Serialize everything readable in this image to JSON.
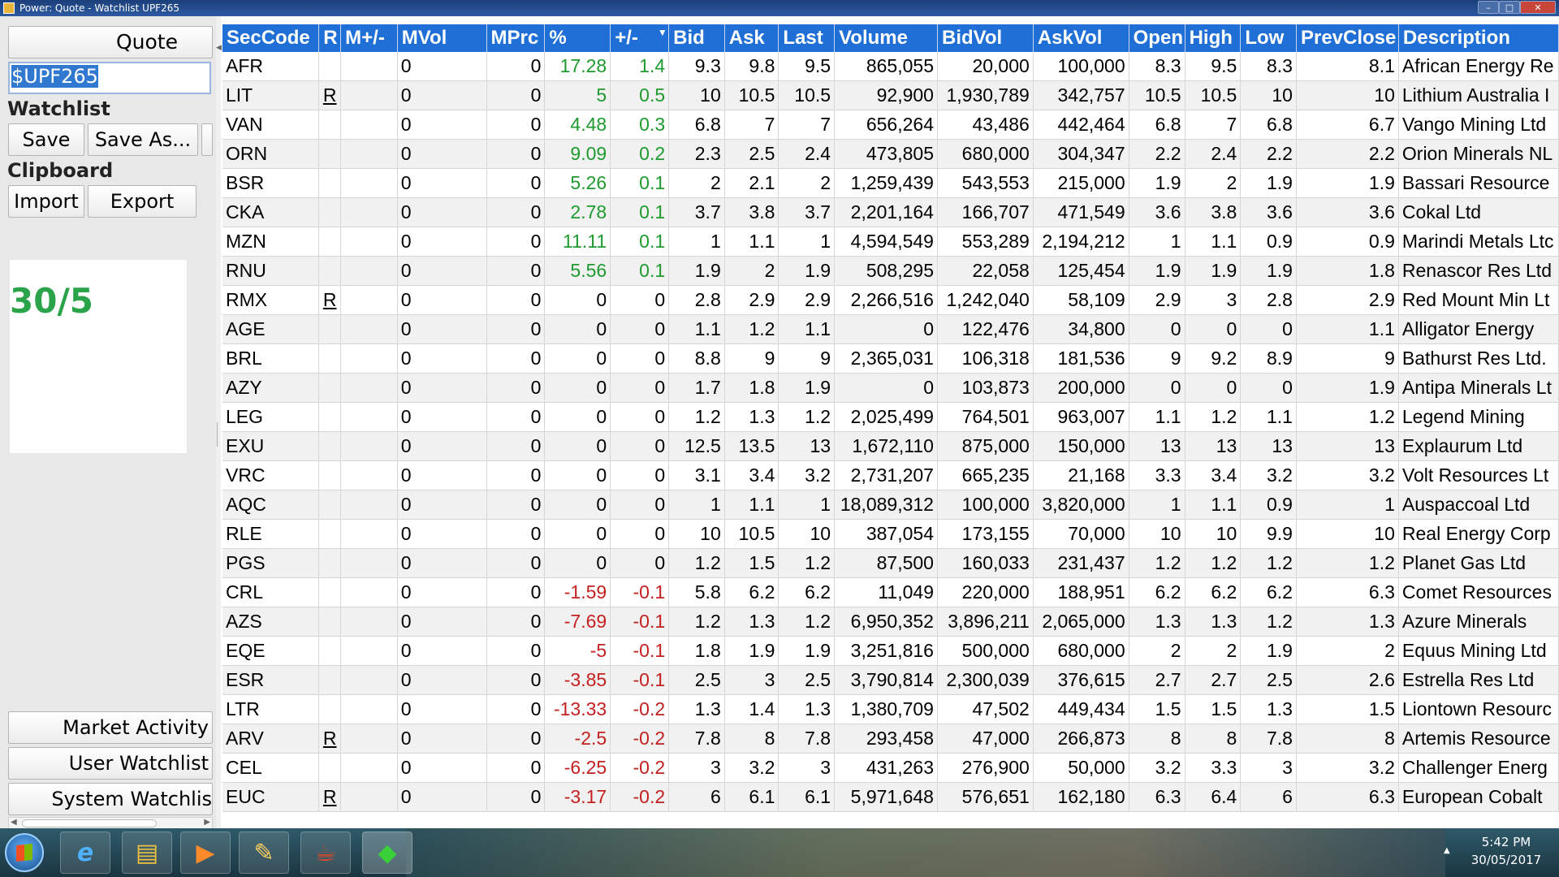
{
  "window": {
    "title": "Power: Quote - Watchlist UPF265"
  },
  "left": {
    "quote_label": "Quote",
    "search_value": "$UPF265",
    "watchlist_label": "Watchlist",
    "save_label": "Save",
    "saveas_label": "Save As...",
    "clipboard_label": "Clipboard",
    "import_label": "Import",
    "export_label": "Export",
    "date_text": "30/5",
    "market_activity_label": "Market Activity",
    "user_watchlist_label": "User Watchlist",
    "system_watchlist_label": "System Watchlis"
  },
  "table": {
    "headers": [
      "SecCode",
      "R",
      "M+/-",
      "MVol",
      "MPrc",
      "%",
      "+/-",
      "Bid",
      "Ask",
      "Last",
      "Volume",
      "BidVol",
      "AskVol",
      "Open",
      "High",
      "Low",
      "PrevClose",
      "Description"
    ],
    "rows": [
      [
        "AFR",
        "",
        "",
        "0",
        "0",
        "17.28",
        "1.4",
        "9.3",
        "9.8",
        "9.5",
        "865,055",
        "20,000",
        "100,000",
        "8.3",
        "9.5",
        "8.3",
        "8.1",
        "African Energy Re"
      ],
      [
        "LIT",
        "R",
        "",
        "0",
        "0",
        "5",
        "0.5",
        "10",
        "10.5",
        "10.5",
        "92,900",
        "1,930,789",
        "342,757",
        "10.5",
        "10.5",
        "10",
        "10",
        "Lithium Australia I"
      ],
      [
        "VAN",
        "",
        "",
        "0",
        "0",
        "4.48",
        "0.3",
        "6.8",
        "7",
        "7",
        "656,264",
        "43,486",
        "442,464",
        "6.8",
        "7",
        "6.8",
        "6.7",
        "Vango Mining Ltd"
      ],
      [
        "ORN",
        "",
        "",
        "0",
        "0",
        "9.09",
        "0.2",
        "2.3",
        "2.5",
        "2.4",
        "473,805",
        "680,000",
        "304,347",
        "2.2",
        "2.4",
        "2.2",
        "2.2",
        "Orion Minerals NL"
      ],
      [
        "BSR",
        "",
        "",
        "0",
        "0",
        "5.26",
        "0.1",
        "2",
        "2.1",
        "2",
        "1,259,439",
        "543,553",
        "215,000",
        "1.9",
        "2",
        "1.9",
        "1.9",
        "Bassari Resource"
      ],
      [
        "CKA",
        "",
        "",
        "0",
        "0",
        "2.78",
        "0.1",
        "3.7",
        "3.8",
        "3.7",
        "2,201,164",
        "166,707",
        "471,549",
        "3.6",
        "3.8",
        "3.6",
        "3.6",
        "Cokal Ltd"
      ],
      [
        "MZN",
        "",
        "",
        "0",
        "0",
        "11.11",
        "0.1",
        "1",
        "1.1",
        "1",
        "4,594,549",
        "553,289",
        "2,194,212",
        "1",
        "1.1",
        "0.9",
        "0.9",
        "Marindi Metals Ltc"
      ],
      [
        "RNU",
        "",
        "",
        "0",
        "0",
        "5.56",
        "0.1",
        "1.9",
        "2",
        "1.9",
        "508,295",
        "22,058",
        "125,454",
        "1.9",
        "1.9",
        "1.9",
        "1.8",
        "Renascor Res Ltd"
      ],
      [
        "RMX",
        "R",
        "",
        "0",
        "0",
        "0",
        "0",
        "2.8",
        "2.9",
        "2.9",
        "2,266,516",
        "1,242,040",
        "58,109",
        "2.9",
        "3",
        "2.8",
        "2.9",
        "Red Mount Min Lt"
      ],
      [
        "AGE",
        "",
        "",
        "0",
        "0",
        "0",
        "0",
        "1.1",
        "1.2",
        "1.1",
        "0",
        "122,476",
        "34,800",
        "0",
        "0",
        "0",
        "1.1",
        "Alligator Energy"
      ],
      [
        "BRL",
        "",
        "",
        "0",
        "0",
        "0",
        "0",
        "8.8",
        "9",
        "9",
        "2,365,031",
        "106,318",
        "181,536",
        "9",
        "9.2",
        "8.9",
        "9",
        "Bathurst Res Ltd."
      ],
      [
        "AZY",
        "",
        "",
        "0",
        "0",
        "0",
        "0",
        "1.7",
        "1.8",
        "1.9",
        "0",
        "103,873",
        "200,000",
        "0",
        "0",
        "0",
        "1.9",
        "Antipa Minerals Lt"
      ],
      [
        "LEG",
        "",
        "",
        "0",
        "0",
        "0",
        "0",
        "1.2",
        "1.3",
        "1.2",
        "2,025,499",
        "764,501",
        "963,007",
        "1.1",
        "1.2",
        "1.1",
        "1.2",
        "Legend Mining"
      ],
      [
        "EXU",
        "",
        "",
        "0",
        "0",
        "0",
        "0",
        "12.5",
        "13.5",
        "13",
        "1,672,110",
        "875,000",
        "150,000",
        "13",
        "13",
        "13",
        "13",
        "Explaurum Ltd"
      ],
      [
        "VRC",
        "",
        "",
        "0",
        "0",
        "0",
        "0",
        "3.1",
        "3.4",
        "3.2",
        "2,731,207",
        "665,235",
        "21,168",
        "3.3",
        "3.4",
        "3.2",
        "3.2",
        "Volt Resources Lt"
      ],
      [
        "AQC",
        "",
        "",
        "0",
        "0",
        "0",
        "0",
        "1",
        "1.1",
        "1",
        "18,089,312",
        "100,000",
        "3,820,000",
        "1",
        "1.1",
        "0.9",
        "1",
        "Auspaccoal Ltd"
      ],
      [
        "RLE",
        "",
        "",
        "0",
        "0",
        "0",
        "0",
        "10",
        "10.5",
        "10",
        "387,054",
        "173,155",
        "70,000",
        "10",
        "10",
        "9.9",
        "10",
        "Real Energy Corp"
      ],
      [
        "PGS",
        "",
        "",
        "0",
        "0",
        "0",
        "0",
        "1.2",
        "1.5",
        "1.2",
        "87,500",
        "160,033",
        "231,437",
        "1.2",
        "1.2",
        "1.2",
        "1.2",
        "Planet Gas Ltd"
      ],
      [
        "CRL",
        "",
        "",
        "0",
        "0",
        "-1.59",
        "-0.1",
        "5.8",
        "6.2",
        "6.2",
        "11,049",
        "220,000",
        "188,951",
        "6.2",
        "6.2",
        "6.2",
        "6.3",
        "Comet Resources"
      ],
      [
        "AZS",
        "",
        "",
        "0",
        "0",
        "-7.69",
        "-0.1",
        "1.2",
        "1.3",
        "1.2",
        "6,950,352",
        "3,896,211",
        "2,065,000",
        "1.3",
        "1.3",
        "1.2",
        "1.3",
        "Azure Minerals"
      ],
      [
        "EQE",
        "",
        "",
        "0",
        "0",
        "-5",
        "-0.1",
        "1.8",
        "1.9",
        "1.9",
        "3,251,816",
        "500,000",
        "680,000",
        "2",
        "2",
        "1.9",
        "2",
        "Equus Mining Ltd"
      ],
      [
        "ESR",
        "",
        "",
        "0",
        "0",
        "-3.85",
        "-0.1",
        "2.5",
        "3",
        "2.5",
        "3,790,814",
        "2,300,039",
        "376,615",
        "2.7",
        "2.7",
        "2.5",
        "2.6",
        "Estrella Res Ltd"
      ],
      [
        "LTR",
        "",
        "",
        "0",
        "0",
        "-13.33",
        "-0.2",
        "1.3",
        "1.4",
        "1.3",
        "1,380,709",
        "47,502",
        "449,434",
        "1.5",
        "1.5",
        "1.3",
        "1.5",
        "Liontown Resourc"
      ],
      [
        "ARV",
        "R",
        "",
        "0",
        "0",
        "-2.5",
        "-0.2",
        "7.8",
        "8",
        "7.8",
        "293,458",
        "47,000",
        "266,873",
        "8",
        "8",
        "7.8",
        "8",
        "Artemis Resource"
      ],
      [
        "CEL",
        "",
        "",
        "0",
        "0",
        "-6.25",
        "-0.2",
        "3",
        "3.2",
        "3",
        "431,263",
        "276,900",
        "50,000",
        "3.2",
        "3.3",
        "3",
        "3.2",
        "Challenger Energ"
      ],
      [
        "EUC",
        "R",
        "",
        "0",
        "0",
        "-3.17",
        "-0.2",
        "6",
        "6.1",
        "6.1",
        "5,971,648",
        "576,651",
        "162,180",
        "6.3",
        "6.4",
        "6",
        "6.3",
        "European Cobalt"
      ]
    ]
  },
  "taskbar": {
    "time": "5:42 PM",
    "date": "30/05/2017",
    "apps": [
      "internet-explorer-icon",
      "file-explorer-icon",
      "media-player-icon",
      "paint-icon",
      "java-icon",
      "power-quote-icon"
    ]
  },
  "colors": {
    "header_bg": "#1f6fd6",
    "positive": "#1e9a2e",
    "negative": "#c42020",
    "date_text": "#2aa34a"
  }
}
